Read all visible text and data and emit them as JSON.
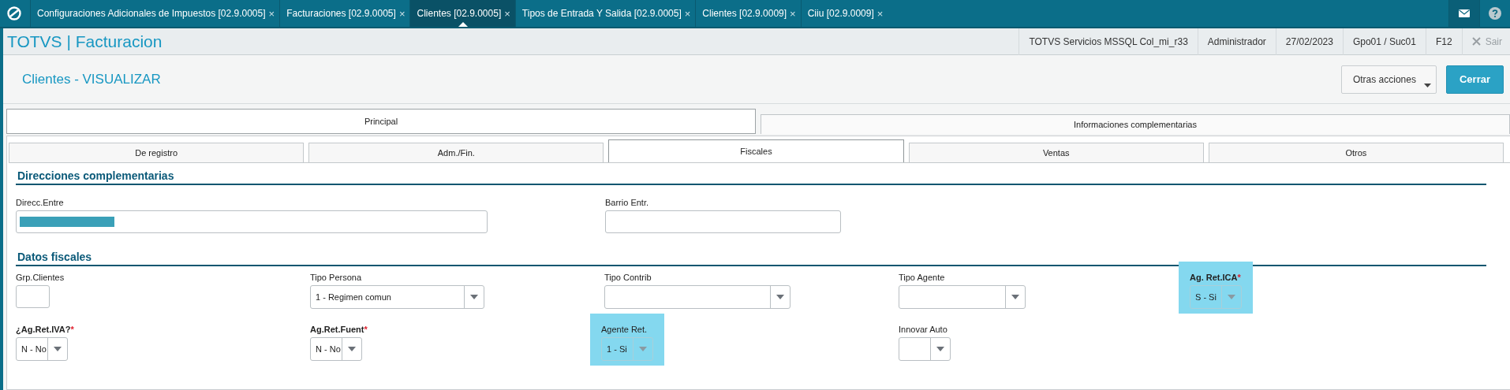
{
  "app_tabs": [
    {
      "label": "Configuraciones Adicionales de Impuestos [02.9.0005]",
      "close": "×",
      "selected": false
    },
    {
      "label": "Facturaciones [02.9.0005]",
      "close": "×",
      "selected": false
    },
    {
      "label": "Clientes [02.9.0005]",
      "close": "×",
      "selected": true
    },
    {
      "label": "Tipos de Entrada Y Salida [02.9.0005]",
      "close": "×",
      "selected": false
    },
    {
      "label": "Clientes [02.9.0009]",
      "close": "×",
      "selected": false
    },
    {
      "label": "Ciiu [02.9.0009]",
      "close": "×",
      "selected": false
    }
  ],
  "app_bar": {
    "title": "TOTVS | Facturacion",
    "info": [
      "TOTVS Servicios MSSQL Col_mi_r33",
      "Administrador",
      "27/02/2023",
      "Gpo01 / Suc01",
      "F12"
    ],
    "exit": {
      "label": "Sair",
      "disabled": true
    }
  },
  "page": {
    "title": "Clientes - VISUALIZAR",
    "buttons": [
      {
        "label": "Otras acciones",
        "kind": "menu"
      },
      {
        "label": "Cerrar",
        "kind": "primary"
      }
    ]
  },
  "main_tabs": [
    {
      "label": "Principal",
      "selected": true
    },
    {
      "label": "Informaciones complementarias",
      "selected": false
    }
  ],
  "sub_tabs": [
    {
      "label": "De registro",
      "selected": false
    },
    {
      "label": "Adm./Fin.",
      "selected": false
    },
    {
      "label": "Fiscales",
      "selected": true
    },
    {
      "label": "Ventas",
      "selected": false
    },
    {
      "label": "Otros",
      "selected": false
    }
  ],
  "sections": [
    {
      "title": "Direcciones complementarias",
      "rows": [
        [
          {
            "label": "Direcc.Entre",
            "kind": "text",
            "masked": true
          },
          {
            "label": "Barrio Entr.",
            "kind": "text"
          }
        ]
      ]
    },
    {
      "title": "Datos fiscales",
      "rows": [
        [
          {
            "label": "Grp.Clientes",
            "kind": "text"
          },
          {
            "label": "Tipo Persona",
            "kind": "select",
            "value": "1 - Regimen comun"
          },
          {
            "label": "Tipo Contrib",
            "kind": "select"
          },
          {
            "label": "Tipo Agente",
            "kind": "select"
          },
          {
            "label": "Ag. Ret.ICA",
            "required_mark": "*",
            "kind": "select",
            "value": "S - Si",
            "highlighted": true,
            "disabled": true
          }
        ],
        [
          {
            "label": "¿Ag.Ret.IVA?",
            "required_mark": "*",
            "kind": "select",
            "value": "N - No"
          },
          {
            "label": "Ag.Ret.Fuent",
            "required_mark": "*",
            "kind": "select",
            "value": "N - No"
          },
          {
            "label": "Agente Ret.",
            "kind": "select",
            "value": "1 - Si",
            "highlighted": true,
            "disabled": true
          },
          {
            "label": "Innovar Auto",
            "kind": "select"
          }
        ]
      ]
    }
  ]
}
